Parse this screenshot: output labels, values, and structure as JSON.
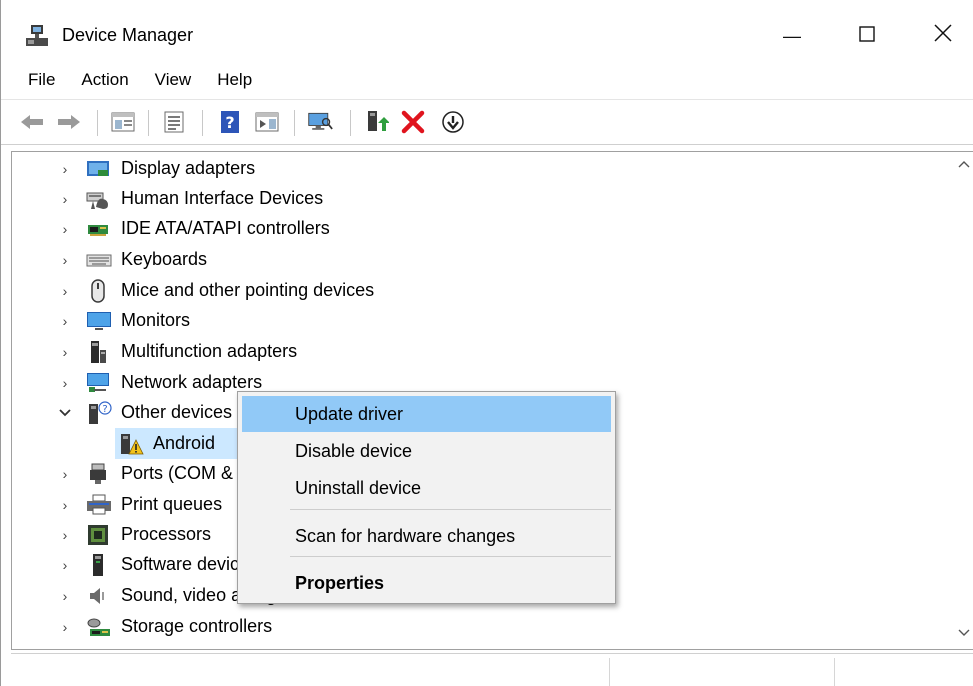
{
  "window": {
    "title": "Device Manager",
    "icon": "device-manager-icon",
    "controls": {
      "minimize": "—",
      "maximize": "☐",
      "close": "✕"
    }
  },
  "menu": [
    "File",
    "Action",
    "View",
    "Help"
  ],
  "toolbar": [
    "back-icon",
    "forward-icon",
    "show-hide-tree-icon",
    "properties-icon",
    "help-icon",
    "show-hide-action-pane-icon",
    "scan-hardware-icon",
    "update-driver-icon",
    "uninstall-device-icon",
    "enable-device-icon"
  ],
  "tree": {
    "items": [
      {
        "label": "Display adapters",
        "icon": "display-adapter-icon",
        "expanded": false
      },
      {
        "label": "Human Interface Devices",
        "icon": "hid-icon",
        "expanded": false
      },
      {
        "label": "IDE ATA/ATAPI controllers",
        "icon": "ide-controller-icon",
        "expanded": false
      },
      {
        "label": "Keyboards",
        "icon": "keyboard-icon",
        "expanded": false
      },
      {
        "label": "Mice and other pointing devices",
        "icon": "mouse-icon",
        "expanded": false
      },
      {
        "label": "Monitors",
        "icon": "monitor-icon",
        "expanded": false
      },
      {
        "label": "Multifunction adapters",
        "icon": "multifunction-icon",
        "expanded": false
      },
      {
        "label": "Network adapters",
        "icon": "network-icon",
        "expanded": false
      },
      {
        "label": "Other devices",
        "icon": "unknown-device-icon",
        "expanded": true
      },
      {
        "label": "Android",
        "icon": "warning-device-icon",
        "child": true,
        "selected": true
      },
      {
        "label": "Ports (COM & LPT)",
        "icon": "port-icon",
        "expanded": false
      },
      {
        "label": "Print queues",
        "icon": "printer-icon",
        "expanded": false
      },
      {
        "label": "Processors",
        "icon": "processor-icon",
        "expanded": false
      },
      {
        "label": "Software devices",
        "icon": "software-device-icon",
        "expanded": false
      },
      {
        "label": "Sound, video and game controllers",
        "icon": "sound-icon",
        "expanded": false
      },
      {
        "label": "Storage controllers",
        "icon": "storage-icon",
        "expanded": false
      }
    ]
  },
  "context_menu": {
    "update_driver": "Update driver",
    "disable_device": "Disable device",
    "uninstall_device": "Uninstall device",
    "scan_hardware": "Scan for hardware changes",
    "properties": "Properties"
  },
  "colors": {
    "highlight": "#91c9f7",
    "selection": "#cce8ff",
    "delete_red": "#e0141e"
  }
}
